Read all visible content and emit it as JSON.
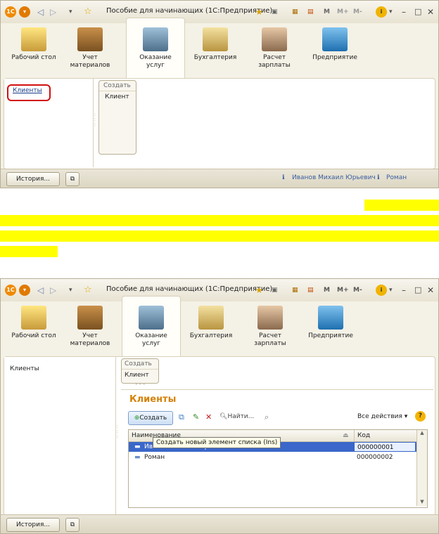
{
  "window_title": "Пособие для начинающих (1С:Предприятие)",
  "titlebar_controls": [
    "M",
    "M+",
    "M-"
  ],
  "sections": [
    {
      "label": "Рабочий стол",
      "icon": "desk-lamp-icon"
    },
    {
      "label": "Учет материалов",
      "icon": "boxes-icon"
    },
    {
      "label": "Оказание услуг",
      "icon": "cash-register-icon"
    },
    {
      "label": "Бухгалтерия",
      "icon": "coins-icon"
    },
    {
      "label": "Расчет зарплаты",
      "icon": "people-icon"
    },
    {
      "label": "Предприятие",
      "icon": "building-icon"
    }
  ],
  "shot1": {
    "nav_link": "Клиенты",
    "create_header": "Создать",
    "create_item": "Клиент",
    "history_button": "История...",
    "user": "Иванов Михаил Юрьевич",
    "user2": "Роман"
  },
  "shot2": {
    "nav_link": "Клиенты",
    "create_header": "Создать",
    "create_item": "Клиент",
    "list_title": "Клиенты",
    "create_button": "Создать",
    "find_button": "Найти...",
    "all_actions": "Все действия",
    "col_name": "Наименование",
    "col_code": "Код",
    "tooltip": "Создать новый элемент списка (Ins)",
    "rows": [
      {
        "name": "Иванов Михаил Юрьевич",
        "code": "000000001"
      },
      {
        "name": "Роман",
        "code": "000000002"
      }
    ],
    "history_button": "История..."
  },
  "colors": {
    "accent_orange": "#f08a00",
    "highlight_red": "#d21010",
    "selection_blue": "#3a67c9",
    "yellow_marker": "#ffff00"
  }
}
